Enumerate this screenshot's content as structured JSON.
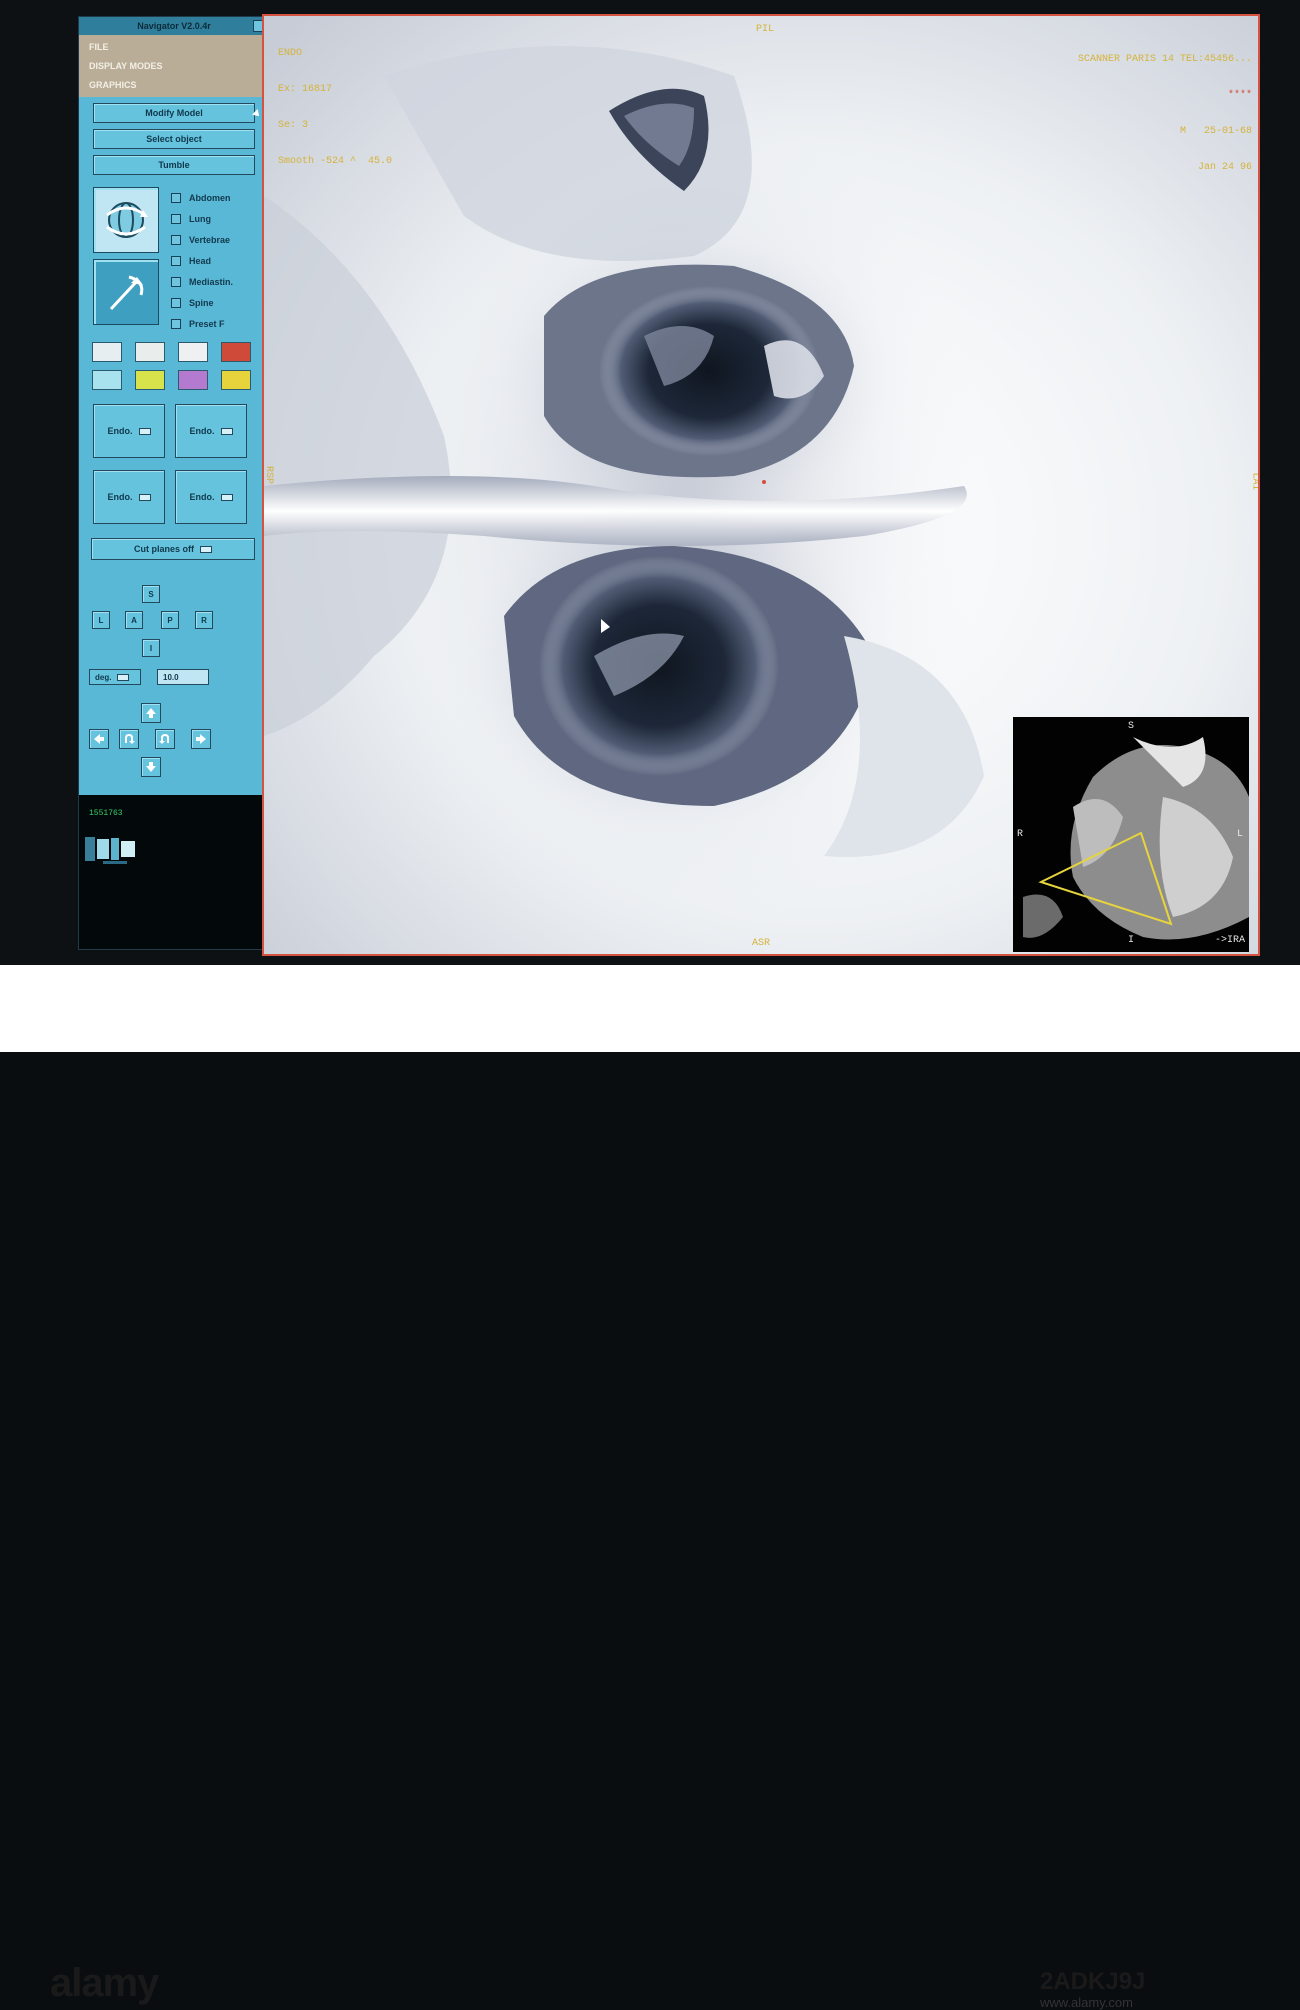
{
  "navigator": {
    "title": "Navigator V2.0.4r",
    "menu": [
      "FILE",
      "DISPLAY MODES",
      "GRAPHICS"
    ],
    "buttons": {
      "modify_model": "Modify Model",
      "select_object": "Select object",
      "tumble": "Tumble"
    },
    "objects": [
      "Abdomen",
      "Lung",
      "Vertebrae",
      "Head",
      "Mediastin.",
      "Spine",
      "Preset F"
    ],
    "swatch_colors": [
      "#e7eef1",
      "#e9edeb",
      "#eef0f2",
      "#d04a3a",
      "#a8e2ee",
      "#d8e34c",
      "#b37ad0",
      "#e7d43c"
    ],
    "endo_labels": [
      "Endo.",
      "Endo.",
      "Endo.",
      "Endo."
    ],
    "cut_planes": "Cut planes off",
    "orient_buttons": [
      "S",
      "L",
      "A",
      "P",
      "R",
      "I"
    ],
    "unit_select": "deg.",
    "step_value": "10.0",
    "counter": "1551763"
  },
  "viewport": {
    "overlay_top_left": [
      "ENDO",
      "Ex: 16817",
      "Se: 3",
      "Smooth -524 ^  45.0"
    ],
    "label_top_center": "PIL",
    "overlay_top_right": [
      "SCANNER PARIS 14 TEL:45456...",
      "****",
      "M   25-01-68",
      "Jan 24 96"
    ],
    "label_left": "RSP",
    "label_right": "LAI",
    "label_bottom": "ASR",
    "inset": {
      "top": "S",
      "left": "R",
      "right": "L",
      "bottom": "I",
      "corner": "->IRA"
    },
    "accent_color": "#d55140",
    "overlay_color": "#d5b33a"
  },
  "footer": {
    "brand": "alamy",
    "image_ref": "2ADKJ9J",
    "url": "www.alamy.com"
  }
}
